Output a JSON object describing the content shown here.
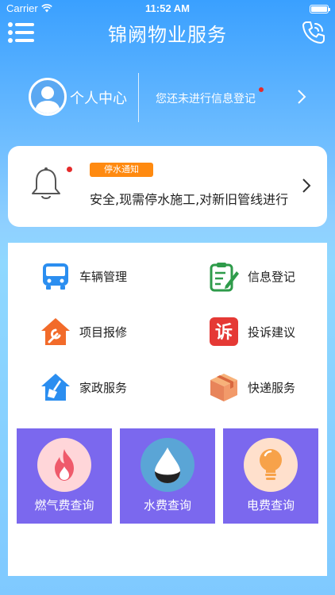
{
  "status_bar": {
    "carrier": "Carrier",
    "time": "11:52 AM"
  },
  "nav": {
    "title": "锦阙物业服务",
    "menu_icon": "menu-list-icon",
    "phone_icon": "phone-icon"
  },
  "profile": {
    "label": "个人中心",
    "registration_prompt": "您还未进行信息登记"
  },
  "notice": {
    "tag": "停水通知",
    "text": "安全,现需停水施工,对新旧管线进行",
    "tag_color": "#ff8a10"
  },
  "services": [
    {
      "label": "车辆管理",
      "icon": "bus-icon"
    },
    {
      "label": "信息登记",
      "icon": "clipboard-icon"
    },
    {
      "label": "项目报修",
      "icon": "repair-house-icon"
    },
    {
      "label": "投诉建议",
      "icon": "complaint-icon"
    },
    {
      "label": "家政服务",
      "icon": "housekeeping-icon"
    },
    {
      "label": "快递服务",
      "icon": "package-icon"
    }
  ],
  "tiles": [
    {
      "label": "燃气费查询",
      "icon": "flame-icon"
    },
    {
      "label": "水费查询",
      "icon": "water-drop-icon"
    },
    {
      "label": "电费查询",
      "icon": "lightbulb-icon"
    }
  ],
  "colors": {
    "tile_bg": "#7b68ee",
    "accent_blue": "#3aa0ff",
    "alert_red": "#e52b2b"
  }
}
